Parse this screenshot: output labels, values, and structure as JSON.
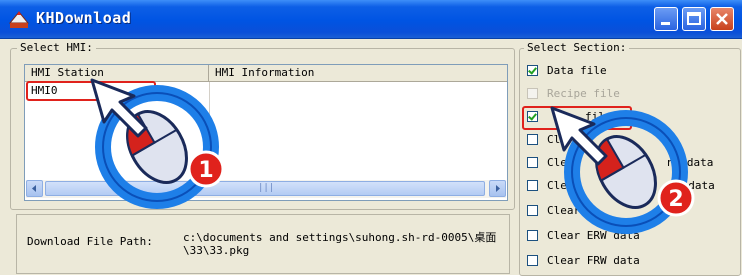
{
  "window": {
    "title": "KHDownload"
  },
  "hmi_group": {
    "label": "Select HMI:",
    "columns": [
      "HMI Station",
      "HMI Information"
    ],
    "rows": [
      {
        "station": "HMI0",
        "information": ""
      }
    ],
    "scrollbar": {
      "thumb_text": "|||"
    }
  },
  "download_path": {
    "label": "Download File Path:",
    "value": "c:\\documents and settings\\suhong.sh-rd-0005\\桌面\\33\\33.pkg"
  },
  "section_group": {
    "label": "Select Section:",
    "items": [
      {
        "label": "Data file",
        "checked": true,
        "enabled": true
      },
      {
        "label": "Recipe file",
        "checked": false,
        "enabled": false
      },
      {
        "label": "file",
        "checked": true,
        "enabled": true
      },
      {
        "label": "Cl",
        "checked": false,
        "enabled": true
      },
      {
        "label": "Cle",
        "label_tail": "nt data",
        "checked": false,
        "enabled": true
      },
      {
        "label": "Cle",
        "label_tail": "d data",
        "checked": false,
        "enabled": true
      },
      {
        "label": "Clear",
        "checked": false,
        "enabled": true
      },
      {
        "label": "Clear ERW data",
        "checked": false,
        "enabled": true
      },
      {
        "label": "Clear FRW data",
        "checked": false,
        "enabled": true
      }
    ]
  },
  "annotations": {
    "step1": "1",
    "step2": "2",
    "highlight_color": "#e0221c",
    "badge_color": "#e0221c",
    "mouse_ring_color": "#1e7fe8"
  }
}
